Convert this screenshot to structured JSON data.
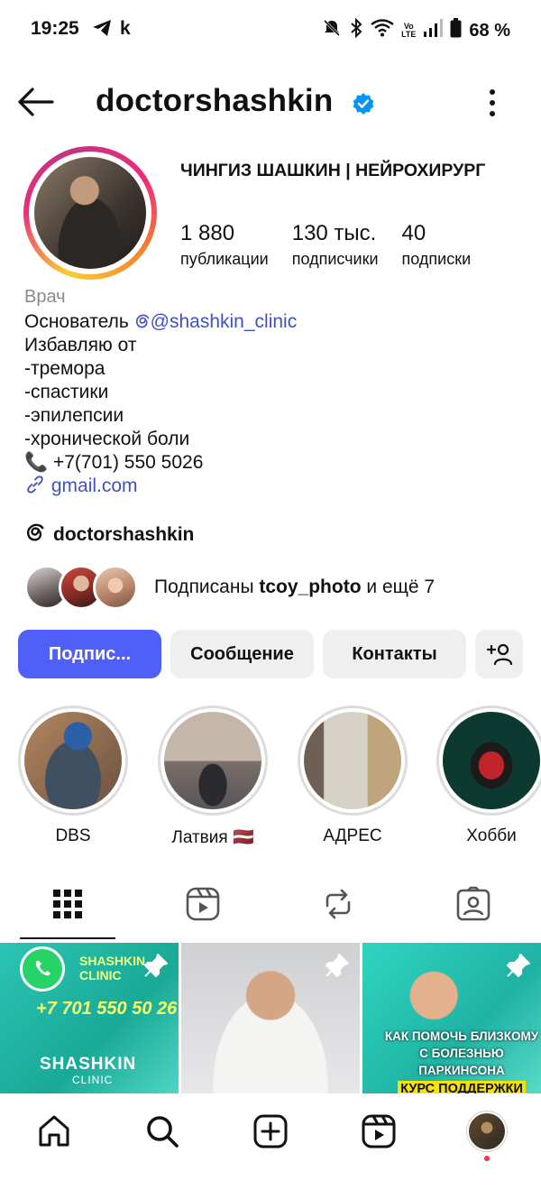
{
  "status_bar": {
    "time": "19:25",
    "k": "k",
    "battery": "68 %",
    "volte_top": "Vo",
    "volte_bottom": "LTE"
  },
  "header": {
    "username": "doctorshashkin"
  },
  "profile": {
    "full_name": "ЧИНГИЗ ШАШКИН | НЕЙРОХИРУРГ",
    "stats": [
      {
        "value": "1 880",
        "label": "публикации"
      },
      {
        "value": "130 тыс.",
        "label": "подписчики"
      },
      {
        "value": "40",
        "label": "подписки"
      }
    ],
    "category": "Врач",
    "bio_founder": "Основатель ",
    "bio_mention": "@shashkin_clinic",
    "bio_lines": [
      "Избавляю от",
      "-тремора",
      "-спастики",
      "-эпилепсии",
      "-хронической боли"
    ],
    "phone": "📞 +7(701) 550 5026",
    "link": "gmail.com",
    "threads": "doctorshashkin",
    "followed_by_prefix": "Подписаны ",
    "followed_by_user": "tcoy_photo",
    "followed_by_suffix": " и ещё 7"
  },
  "buttons": {
    "follow": "Подпис...",
    "message": "Сообщение",
    "contacts": "Контакты"
  },
  "highlights": [
    {
      "label": "DBS"
    },
    {
      "label": "Латвия 🇱🇻"
    },
    {
      "label": "АДРЕС"
    },
    {
      "label": "Хобби"
    }
  ],
  "posts": {
    "p1_brand": "SHASHKIN CLINIC",
    "p1_phone": "+7 701 550 50 26",
    "p1_name": "SHASHKIN",
    "p1_sub": "CLINIC",
    "p3_line1": "КАК ПОМОЧЬ БЛИЗКОМУ",
    "p3_line2": "С БОЛЕЗНЬЮ ПАРКИНСОНА",
    "p3_line3": "КУРС ПОДДЕРЖКИ"
  },
  "colors": {
    "follow_button": "#4f5ff7",
    "link": "#4150c2",
    "verified": "#0095f6"
  }
}
